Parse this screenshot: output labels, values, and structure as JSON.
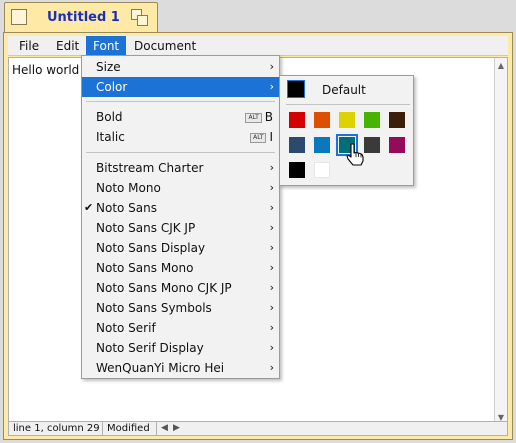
{
  "window": {
    "title": "Untitled 1"
  },
  "menubar": {
    "items": [
      "File",
      "Edit",
      "Font",
      "Document"
    ],
    "active": "Font"
  },
  "editor": {
    "text": "Hello world! I"
  },
  "status": {
    "position": "line 1, column 29",
    "state": "Modified"
  },
  "font_menu": {
    "size": "Size",
    "color": "Color",
    "bold": "Bold",
    "bold_key": "B",
    "italic": "Italic",
    "italic_key": "I",
    "alt_key": "ALT",
    "check_mark": "✔",
    "fonts": [
      "Bitstream Charter",
      "Noto Mono",
      "Noto Sans",
      "Noto Sans CJK JP",
      "Noto Sans Display",
      "Noto Sans Mono",
      "Noto Sans Mono CJK JP",
      "Noto Sans Symbols",
      "Noto Serif",
      "Noto Serif Display",
      "WenQuanYi Micro Hei"
    ],
    "checked_font": "Noto Sans"
  },
  "color_menu": {
    "default_label": "Default",
    "colors": [
      "#d40000",
      "#dc5000",
      "#dcd200",
      "#46b400",
      "#3c1e0a",
      "#2a4a6e",
      "#0a78be",
      "#006e78",
      "#3a3a3a",
      "#960a5a",
      "#000000",
      "#ffffff"
    ],
    "selected": "#006e78"
  },
  "accent": "#1d72d6"
}
